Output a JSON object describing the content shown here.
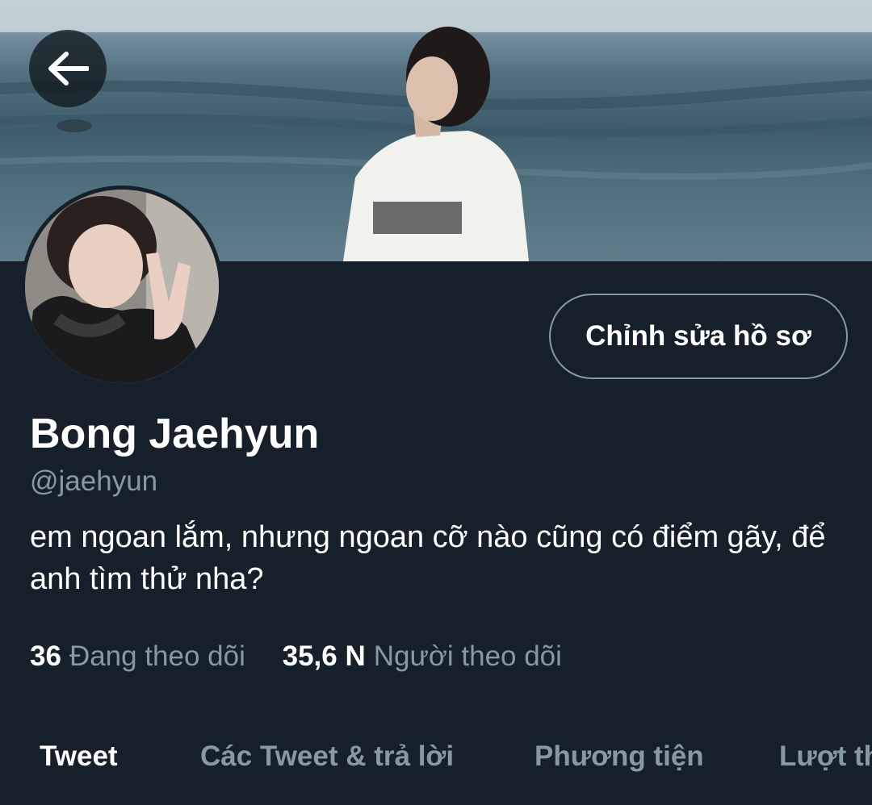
{
  "header": {
    "back_icon": "arrow-left-icon",
    "banner": "cover-photo"
  },
  "profile": {
    "avatar": "profile-photo",
    "edit_button_label": "Chỉnh sửa hồ sơ",
    "display_name": "Bong Jaehyun",
    "handle": "@jaehyun",
    "bio": "em ngoan lắm, nhưng ngoan cỡ nào cũng có điểm gãy, để anh tìm thử nha?",
    "following_count": "36",
    "following_label": "Đang theo dõi",
    "followers_count": "35,6 N",
    "followers_label": "Người theo dõi"
  },
  "tabs": [
    {
      "label": "Tweet",
      "active": true
    },
    {
      "label": "Các Tweet & trả lời",
      "active": false
    },
    {
      "label": "Phương tiện",
      "active": false
    },
    {
      "label": "Lượt thích",
      "active": false
    }
  ],
  "colors": {
    "background": "#15202b",
    "text_primary": "#ffffff",
    "text_secondary": "#8899a6",
    "button_border": "#8899a6"
  }
}
